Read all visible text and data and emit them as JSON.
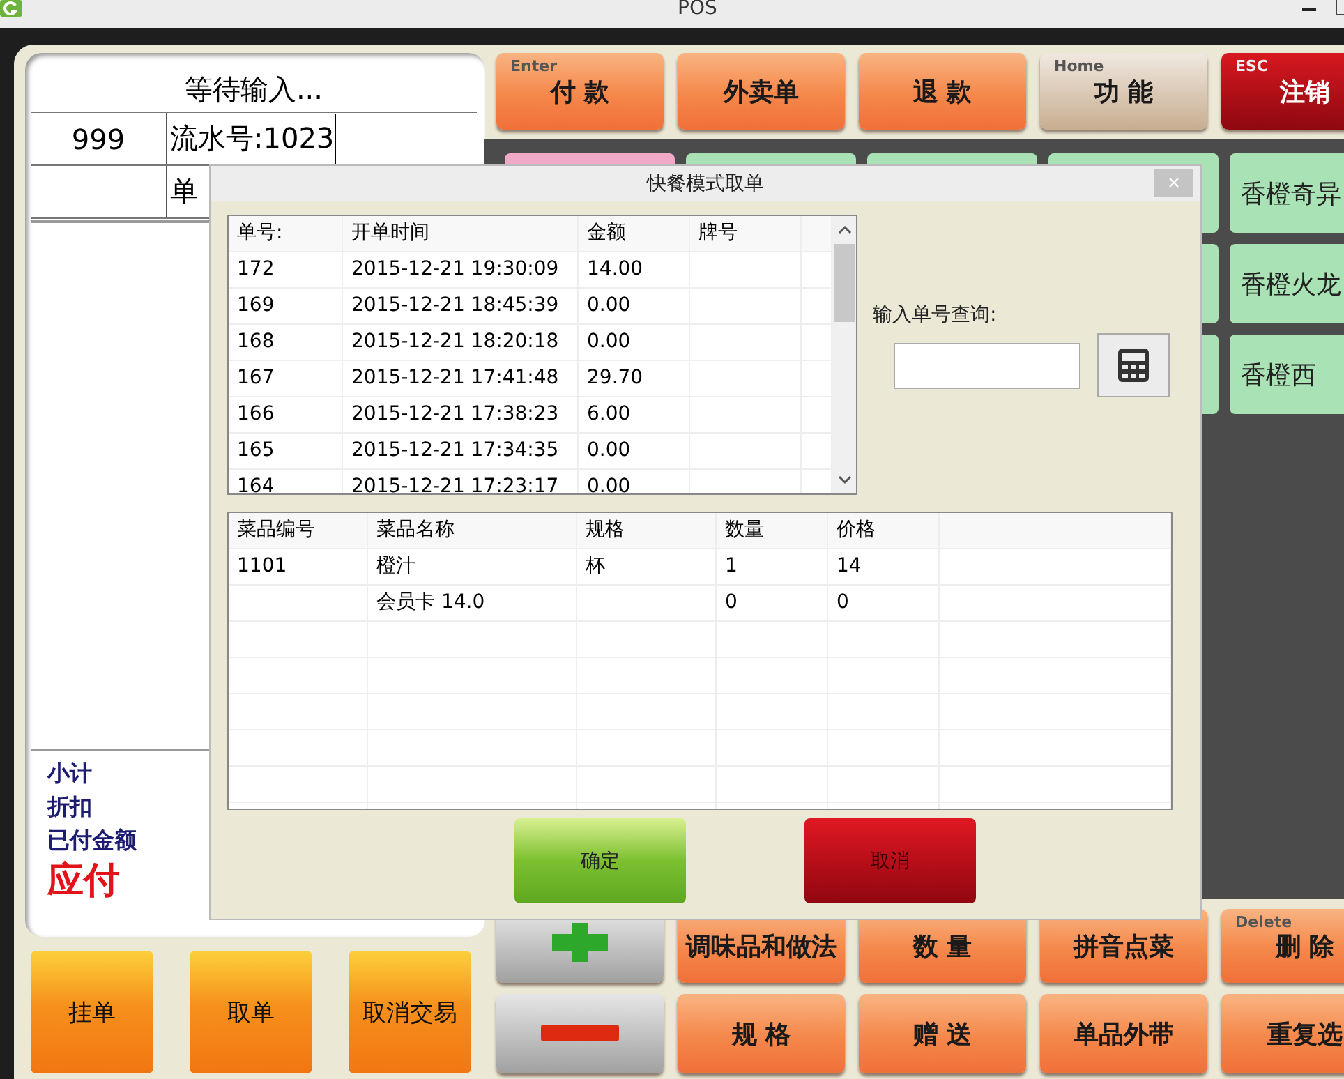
{
  "window": {
    "title": "POS"
  },
  "order_panel": {
    "status": "等待输入...",
    "terminal": "999",
    "serial": "流水号:1023",
    "order_no": "单",
    "summary": [
      {
        "label": "小计",
        "kind": "normal"
      },
      {
        "label": "折扣",
        "kind": "normal"
      },
      {
        "label": "已付金额",
        "kind": "normal"
      },
      {
        "label": "应付",
        "kind": "due"
      }
    ]
  },
  "order_actions": [
    "挂单",
    "取单",
    "取消交易"
  ],
  "top_buttons": [
    {
      "label": "付 款",
      "hotkey": "Enter",
      "kind": "action"
    },
    {
      "label": "外卖单",
      "kind": "action"
    },
    {
      "label": "退 款",
      "kind": "action"
    },
    {
      "label": "功 能",
      "hotkey": "Home",
      "kind": "function"
    },
    {
      "label": "注销",
      "hotkey": "ESC",
      "kind": "exit"
    }
  ],
  "product_tiles": [
    [
      {
        "color": "#f2a9c8"
      },
      {
        "color": "#a9e2b4"
      },
      {
        "color": "#a9e2b4"
      },
      {
        "color": "#a9e2b4"
      },
      {
        "label": "香橙奇异",
        "color": "#a9e2b4"
      }
    ],
    [
      {
        "color": "#a9e2b4"
      },
      {
        "label": "香橙火龙",
        "color": "#a9e2b4"
      }
    ],
    [
      {
        "color": "#a9e2b4"
      },
      {
        "label": "香橙西",
        "color": "#a9e2b4"
      }
    ]
  ],
  "bottom_buttons": [
    [
      {
        "kind": "plus"
      },
      {
        "kind": "text",
        "label": "调味品和做法"
      },
      {
        "kind": "text",
        "label": "数 量"
      },
      {
        "kind": "text",
        "label": "拼音点菜"
      },
      {
        "kind": "text",
        "label": "删 除",
        "hotkey": "Delete"
      }
    ],
    [
      {
        "kind": "minus"
      },
      {
        "kind": "text",
        "label": "规 格"
      },
      {
        "kind": "text",
        "label": "赠 送"
      },
      {
        "kind": "text",
        "label": "单品外带"
      },
      {
        "kind": "text",
        "label": "重复选"
      }
    ]
  ],
  "dialog": {
    "title": "快餐模式取单",
    "close": "×",
    "orders": {
      "columns": [
        "单号:",
        "开单时间",
        "金额",
        "牌号"
      ],
      "rows": [
        {
          "no": "172",
          "time": "2015-12-21 19:30:09",
          "amount": "14.00"
        },
        {
          "no": "169",
          "time": "2015-12-21 18:45:39",
          "amount": "0.00"
        },
        {
          "no": "168",
          "time": "2015-12-21 18:20:18",
          "amount": "0.00"
        },
        {
          "no": "167",
          "time": "2015-12-21 17:41:48",
          "amount": "29.70"
        },
        {
          "no": "166",
          "time": "2015-12-21 17:38:23",
          "amount": "6.00"
        },
        {
          "no": "165",
          "time": "2015-12-21 17:34:35",
          "amount": "0.00"
        },
        {
          "no": "164",
          "time": "2015-12-21 17:23:17",
          "amount": "0.00"
        }
      ]
    },
    "search": {
      "label": "输入单号查询:"
    },
    "items": {
      "columns": [
        "菜品编号",
        "菜品名称",
        "规格",
        "数量",
        "价格"
      ],
      "rows": [
        {
          "code": "1101",
          "name": "橙汁",
          "spec": "杯",
          "qty": "1",
          "price": "14"
        },
        {
          "name": "会员卡 14.0",
          "qty": "0",
          "price": "0"
        }
      ]
    },
    "buttons": [
      {
        "label": "确定",
        "kind": "confirm"
      },
      {
        "label": "取消",
        "kind": "cancel"
      }
    ]
  }
}
